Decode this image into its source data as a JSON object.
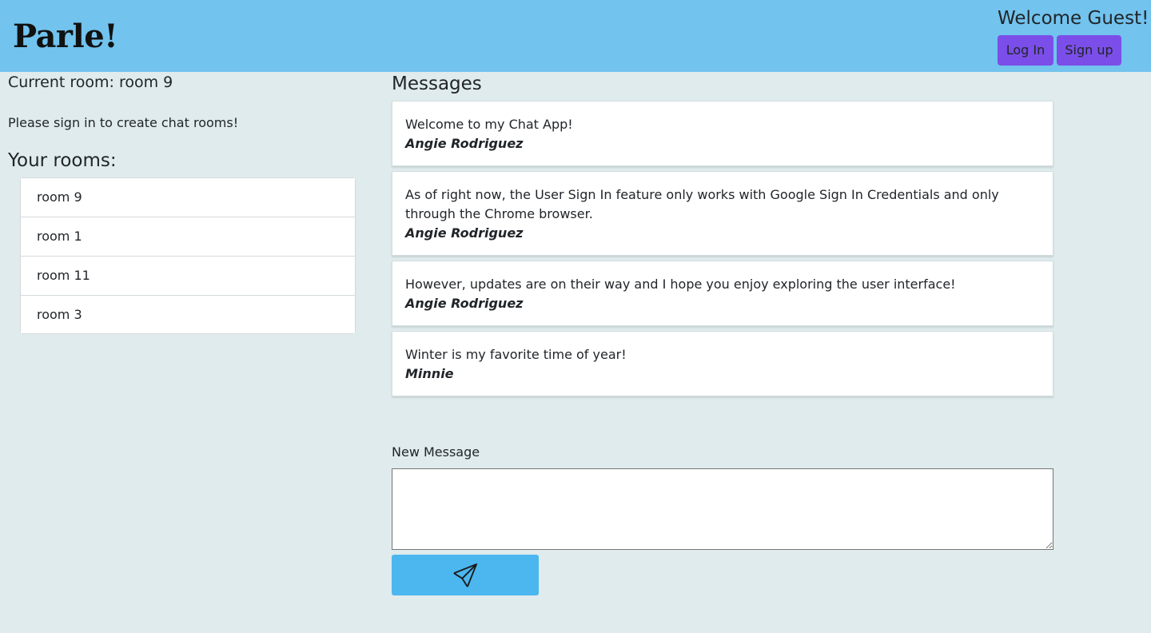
{
  "header": {
    "brand": "Parle!",
    "welcome": "Welcome Guest!",
    "login_label": "Log In",
    "signup_label": "Sign up"
  },
  "sidebar": {
    "current_room": "Current room: room 9",
    "signin_note": "Please sign in to create chat rooms!",
    "rooms_heading": "Your rooms:",
    "rooms": [
      {
        "label": "room 9"
      },
      {
        "label": "room 1"
      },
      {
        "label": "room 11"
      },
      {
        "label": "room 3"
      }
    ]
  },
  "main": {
    "messages_heading": "Messages",
    "messages": [
      {
        "text": "Welcome to my Chat App!",
        "author": "Angie Rodriguez"
      },
      {
        "text": "As of right now, the User Sign In feature only works with Google Sign In Credentials and only through the Chrome browser.",
        "author": "Angie Rodriguez"
      },
      {
        "text": "However, updates are on their way and I hope you enjoy exploring the user interface!",
        "author": "Angie Rodriguez"
      },
      {
        "text": "Winter is my favorite time of year!",
        "author": "Minnie"
      }
    ],
    "new_message_label": "New Message",
    "new_message_value": "",
    "send_icon": "paper-plane-icon"
  },
  "colors": {
    "header_bg": "#72c3ee",
    "page_bg": "#dfebec",
    "auth_button_bg": "#7b4ee9",
    "send_button_bg": "#4cb6ef"
  }
}
